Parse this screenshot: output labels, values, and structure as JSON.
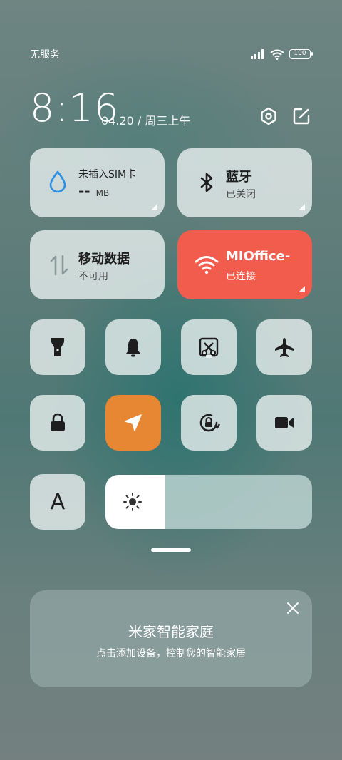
{
  "status": {
    "carrier": "无服务",
    "battery": "100"
  },
  "header": {
    "time": "8:16",
    "date": "04.20 / 周三上午"
  },
  "tiles": {
    "sim": {
      "title": "未插入SIM卡",
      "value": "--",
      "unit": "MB"
    },
    "bluetooth": {
      "title": "蓝牙",
      "status": "已关闭"
    },
    "mobile_data": {
      "title": "移动数据",
      "status": "不可用"
    },
    "wifi": {
      "title": "MIOffice-",
      "status": "已连接"
    }
  },
  "toggles": [
    {
      "name": "flashlight",
      "icon": "flashlight-icon",
      "active": false
    },
    {
      "name": "mute",
      "icon": "bell-icon",
      "active": false
    },
    {
      "name": "screenshot",
      "icon": "scissors-screenshot-icon",
      "active": false
    },
    {
      "name": "airplane",
      "icon": "airplane-icon",
      "active": false
    },
    {
      "name": "lock-screen",
      "icon": "lock-icon",
      "active": false
    },
    {
      "name": "location",
      "icon": "location-arrow-icon",
      "active": true
    },
    {
      "name": "rotation-lock",
      "icon": "rotation-lock-icon",
      "active": false
    },
    {
      "name": "screen-record",
      "icon": "video-camera-icon",
      "active": false
    }
  ],
  "font_toggle": {
    "label": "A"
  },
  "brightness": {
    "level": 0.29
  },
  "mijia_card": {
    "title": "米家智能家庭",
    "subtitle": "点击添加设备，控制您的智能家居"
  },
  "colors": {
    "accent_red": "#f25c4d",
    "accent_orange": "#e78733",
    "tile_bg": "#e8f0ef"
  }
}
